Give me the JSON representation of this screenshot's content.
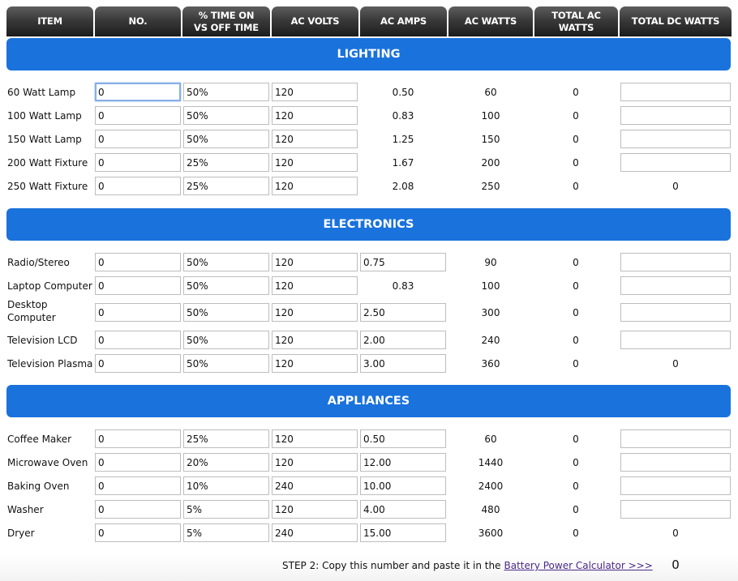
{
  "columns": [
    "ITEM",
    "NO.",
    "% TIME ON\nVS OFF TIME",
    "AC VOLTS",
    "AC AMPS",
    "AC WATTS",
    "TOTAL AC WATTS",
    "TOTAL DC WATTS"
  ],
  "sections": [
    {
      "title": "LIGHTING",
      "rows": [
        {
          "item": "60 Watt Lamp",
          "no": "0",
          "pct": "50%",
          "volts": "120",
          "amps": "0.50",
          "amps_editable": false,
          "watts": "60",
          "total_ac": "0",
          "total_dc": "",
          "dc_editable": true
        },
        {
          "item": "100 Watt Lamp",
          "no": "0",
          "pct": "50%",
          "volts": "120",
          "amps": "0.83",
          "amps_editable": false,
          "watts": "100",
          "total_ac": "0",
          "total_dc": "",
          "dc_editable": true
        },
        {
          "item": "150 Watt Lamp",
          "no": "0",
          "pct": "50%",
          "volts": "120",
          "amps": "1.25",
          "amps_editable": false,
          "watts": "150",
          "total_ac": "0",
          "total_dc": "",
          "dc_editable": true
        },
        {
          "item": "200 Watt Fixture",
          "no": "0",
          "pct": "25%",
          "volts": "120",
          "amps": "1.67",
          "amps_editable": false,
          "watts": "200",
          "total_ac": "0",
          "total_dc": "",
          "dc_editable": true
        },
        {
          "item": "250 Watt Fixture",
          "no": "0",
          "pct": "25%",
          "volts": "120",
          "amps": "2.08",
          "amps_editable": false,
          "watts": "250",
          "total_ac": "0",
          "total_dc": "0",
          "dc_editable": false
        }
      ]
    },
    {
      "title": "ELECTRONICS",
      "rows": [
        {
          "item": "Radio/Stereo",
          "no": "0",
          "pct": "50%",
          "volts": "120",
          "amps": "0.75",
          "amps_editable": true,
          "watts": "90",
          "total_ac": "0",
          "total_dc": "",
          "dc_editable": true
        },
        {
          "item": "Laptop Computer",
          "no": "0",
          "pct": "50%",
          "volts": "120",
          "amps": "0.83",
          "amps_editable": false,
          "watts": "100",
          "total_ac": "0",
          "total_dc": "",
          "dc_editable": true
        },
        {
          "item": "Desktop Computer",
          "no": "0",
          "pct": "50%",
          "volts": "120",
          "amps": "2.50",
          "amps_editable": true,
          "watts": "300",
          "total_ac": "0",
          "total_dc": "",
          "dc_editable": true
        },
        {
          "item": "Television LCD",
          "no": "0",
          "pct": "50%",
          "volts": "120",
          "amps": "2.00",
          "amps_editable": true,
          "watts": "240",
          "total_ac": "0",
          "total_dc": "",
          "dc_editable": true
        },
        {
          "item": "Television Plasma",
          "no": "0",
          "pct": "50%",
          "volts": "120",
          "amps": "3.00",
          "amps_editable": true,
          "watts": "360",
          "total_ac": "0",
          "total_dc": "0",
          "dc_editable": false
        }
      ]
    },
    {
      "title": "APPLIANCES",
      "rows": [
        {
          "item": "Coffee Maker",
          "no": "0",
          "pct": "25%",
          "volts": "120",
          "amps": "0.50",
          "amps_editable": true,
          "watts": "60",
          "total_ac": "0",
          "total_dc": "",
          "dc_editable": true
        },
        {
          "item": "Microwave Oven",
          "no": "0",
          "pct": "20%",
          "volts": "120",
          "amps": "12.00",
          "amps_editable": true,
          "watts": "1440",
          "total_ac": "0",
          "total_dc": "",
          "dc_editable": true
        },
        {
          "item": "Baking Oven",
          "no": "0",
          "pct": "10%",
          "volts": "240",
          "amps": "10.00",
          "amps_editable": true,
          "watts": "2400",
          "total_ac": "0",
          "total_dc": "",
          "dc_editable": true
        },
        {
          "item": "Washer",
          "no": "0",
          "pct": "5%",
          "volts": "120",
          "amps": "4.00",
          "amps_editable": true,
          "watts": "480",
          "total_ac": "0",
          "total_dc": "",
          "dc_editable": true
        },
        {
          "item": "Dryer",
          "no": "0",
          "pct": "5%",
          "volts": "240",
          "amps": "15.00",
          "amps_editable": true,
          "watts": "3600",
          "total_ac": "0",
          "total_dc": "0",
          "dc_editable": false
        }
      ]
    }
  ],
  "footer": {
    "text": "STEP 2: Copy this number and paste it in the",
    "link": "Battery Power Calculator >>>",
    "total": "0"
  },
  "colors": {
    "band": "#1a72dc",
    "header": "#2e2e2e",
    "focus": "#86aee6",
    "link": "#4a2a8a"
  }
}
